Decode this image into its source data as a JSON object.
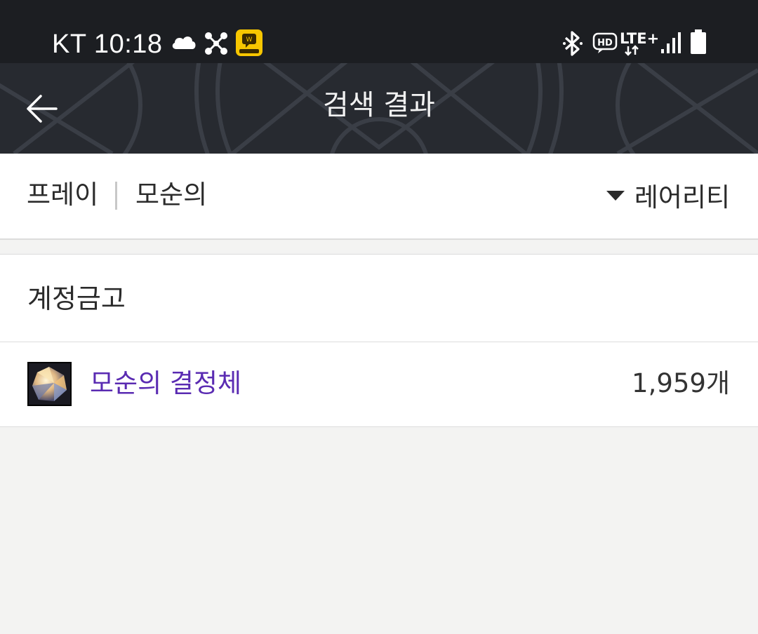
{
  "status_bar": {
    "carrier_time": "KT 10:18",
    "icons": [
      "cloud-icon",
      "nodes-icon",
      "messenger-app-icon",
      "bluetooth-icon",
      "hd-voice-icon",
      "lte-plus-icon",
      "signal-icon",
      "battery-icon"
    ],
    "hd_label": "HD",
    "lte_label": "LTE+"
  },
  "header": {
    "back_icon": "back-arrow-icon",
    "title": "검색 결과"
  },
  "filter_bar": {
    "filter_1": "프레이",
    "filter_2": "모순의",
    "sort_label": "레어리티"
  },
  "section": {
    "title": "계정금고",
    "results": [
      {
        "icon": "crystal-item-icon",
        "name": "모순의 결정체",
        "count": "1,959개"
      }
    ]
  },
  "colors": {
    "status_bar_bg": "#1c1e22",
    "header_bg": "#272a30",
    "item_name": "#5a2bb2",
    "page_bg": "#f3f3f2"
  }
}
